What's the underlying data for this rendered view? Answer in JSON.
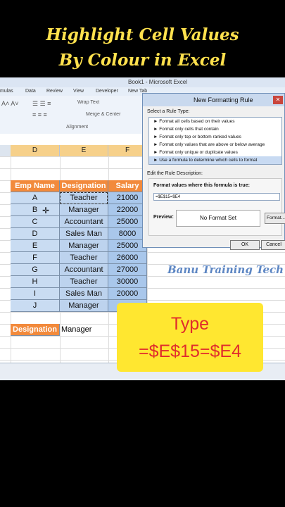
{
  "banner": {
    "line1": "Highlight Cell Values",
    "line2": "By Colour in Excel"
  },
  "window": {
    "title": "Book1 - Microsoft Excel"
  },
  "menu": {
    "items": [
      "mulas",
      "Data",
      "Review",
      "View",
      "Developer",
      "New Tab"
    ]
  },
  "ribbon": {
    "wrap_text": "Wrap Text",
    "merge_center": "Merge & Center",
    "alignment": "Alignment"
  },
  "columns": [
    "D",
    "E",
    "F"
  ],
  "table": {
    "headers": [
      "Emp Name",
      "Designation",
      "Salary"
    ],
    "rows": [
      [
        "A",
        "Teacher",
        "21000"
      ],
      [
        "B",
        "Manager",
        "22000"
      ],
      [
        "C",
        "Accountant",
        "25000"
      ],
      [
        "D",
        "Sales Man",
        "8000"
      ],
      [
        "E",
        "Manager",
        "25000"
      ],
      [
        "F",
        "Teacher",
        "26000"
      ],
      [
        "G",
        "Accountant",
        "27000"
      ],
      [
        "H",
        "Teacher",
        "30000"
      ],
      [
        "I",
        "Sales Man",
        "20000"
      ],
      [
        "J",
        "Manager",
        ""
      ]
    ]
  },
  "criteria": {
    "label": "Designation",
    "value": "Manager"
  },
  "dialog": {
    "title": "New Formatting Rule",
    "select_label": "Select a Rule Type:",
    "rule_types": [
      "► Format all cells based on their values",
      "► Format only cells that contain",
      "► Format only top or bottom ranked values",
      "► Format only values that are above or below average",
      "► Format only unique or duplicate values",
      "► Use a formula to determine which cells to format"
    ],
    "edit_label": "Edit the Rule Description:",
    "formula_label": "Format values where this formula is true:",
    "formula_value": "=$E$15=$E4",
    "preview_label": "Preview:",
    "preview_text": "No Format Set",
    "format_button": "Format...",
    "ok": "OK",
    "cancel": "Cancel"
  },
  "watermark": "Banu Training Tech",
  "callout": {
    "line1": "Type",
    "line2": "=$E$15=$E4"
  },
  "colors": {
    "header": "#f28a3c",
    "callout_bg": "#ffe730",
    "callout_text": "#e02c2c",
    "banner_text": "#ffe14d"
  }
}
